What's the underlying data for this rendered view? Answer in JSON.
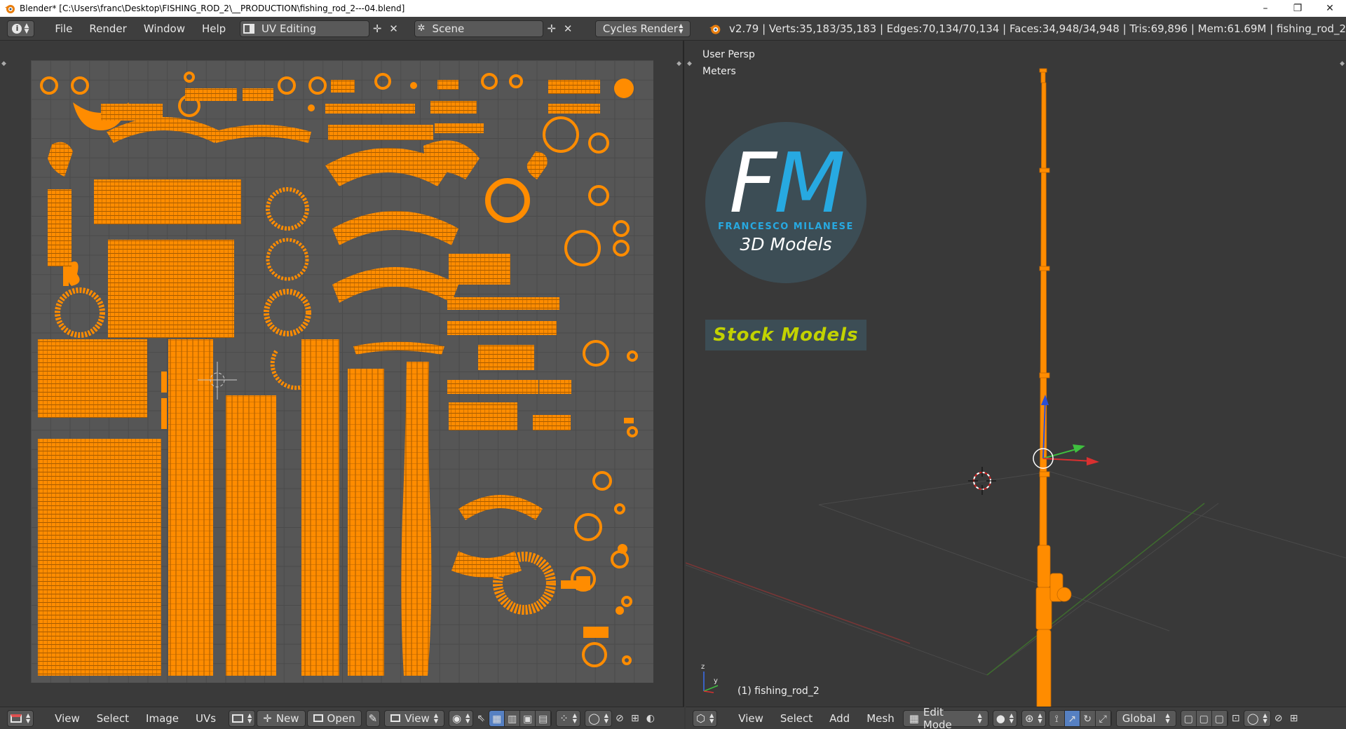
{
  "window": {
    "title": "Blender* [C:\\Users\\franc\\Desktop\\FISHING_ROD_2\\__PRODUCTION\\fishing_rod_2---04.blend]",
    "minimize": "–",
    "maximize": "❐",
    "close": "✕"
  },
  "topbar": {
    "menus": [
      "File",
      "Render",
      "Window",
      "Help"
    ],
    "layout": "UV Editing",
    "scene": "Scene",
    "render_engine": "Cycles Render",
    "stats": "v2.79 | Verts:35,183/35,183 | Edges:70,134/70,134 | Faces:34,948/34,948 | Tris:69,896 | Mem:61.69M | fishing_rod_2"
  },
  "viewport": {
    "view_name": "User Persp",
    "units": "Meters",
    "object_label": "(1) fishing_rod_2",
    "logo": {
      "initial_f": "F",
      "initial_m": "M",
      "author": "FRANCESCO MILANESE",
      "subtitle": "3D Models",
      "stock": "Stock Models"
    }
  },
  "uv_bottom": {
    "menus": [
      "View",
      "Select",
      "Image",
      "UVs"
    ],
    "new_label": "New",
    "open_label": "Open",
    "view_label": "View"
  },
  "vp_bottom": {
    "menus": [
      "View",
      "Select",
      "Add",
      "Mesh"
    ],
    "mode": "Edit Mode",
    "orientation": "Global"
  },
  "colors": {
    "uv_orange": "#ff8c00",
    "accent_blue": "#27a9e1",
    "stock_yellow": "#c2d200"
  }
}
